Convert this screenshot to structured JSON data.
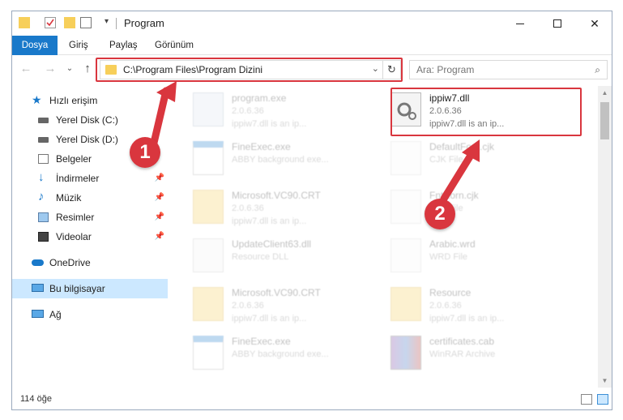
{
  "window": {
    "title": "Program"
  },
  "ribbon": {
    "tabs": [
      "Dosya",
      "Giriş",
      "Paylaş",
      "Görünüm"
    ]
  },
  "address": {
    "path": "C:\\Program Files\\Program Dizini"
  },
  "search": {
    "placeholder": "Ara: Program"
  },
  "sidebar": {
    "items": [
      {
        "label": "Hızlı erişim",
        "icon": "star-icon"
      },
      {
        "label": "Yerel Disk (C:)",
        "icon": "drive-icon"
      },
      {
        "label": "Yerel Disk (D:)",
        "icon": "drive-icon"
      },
      {
        "label": "Belgeler",
        "icon": "documents-icon"
      },
      {
        "label": "İndirmeler",
        "icon": "download-icon"
      },
      {
        "label": "Müzik",
        "icon": "music-icon"
      },
      {
        "label": "Resimler",
        "icon": "pictures-icon"
      },
      {
        "label": "Videolar",
        "icon": "video-icon"
      },
      {
        "label": "OneDrive",
        "icon": "cloud-icon"
      },
      {
        "label": "Bu bilgisayar",
        "icon": "computer-icon"
      },
      {
        "label": "Ağ",
        "icon": "network-icon"
      }
    ]
  },
  "files": [
    {
      "name": "program.exe",
      "line2": "2.0.6.36",
      "line3": "ippiw7.dll is an ip..."
    },
    {
      "name": "ippiw7.dll",
      "line2": "2.0.6.36",
      "line3": "ippiw7.dll is an ip..."
    },
    {
      "name": "FineExec.exe",
      "line2": "ABBY background exe...",
      "line3": ""
    },
    {
      "name": "DefaultFont.cjk",
      "line2": "CJK File",
      "line3": ""
    },
    {
      "name": "Microsoft.VC90.CRT",
      "line2": "2.0.6.36",
      "line3": "ippiw7.dll is an ip..."
    },
    {
      "name": "FntKorn.cjk",
      "line2": "CJK File",
      "line3": ""
    },
    {
      "name": "UpdateClient63.dll",
      "line2": "Resource DLL",
      "line3": ""
    },
    {
      "name": "Arabic.wrd",
      "line2": "WRD File",
      "line3": ""
    },
    {
      "name": "Microsoft.VC90.CRT",
      "line2": "2.0.6.36",
      "line3": "ippiw7.dll is an ip..."
    },
    {
      "name": "Resource",
      "line2": "2.0.6.36",
      "line3": "ippiw7.dll is an ip..."
    },
    {
      "name": "FineExec.exe",
      "line2": "ABBY background exe...",
      "line3": ""
    },
    {
      "name": "certificates.cab",
      "line2": "WinRAR Archive",
      "line3": ""
    }
  ],
  "status": {
    "count": "114 öğe"
  },
  "annotations": {
    "badge1": "1",
    "badge2": "2"
  },
  "colors": {
    "accent": "#1979ca",
    "highlight": "#d9363e",
    "selected": "#cce8ff"
  }
}
